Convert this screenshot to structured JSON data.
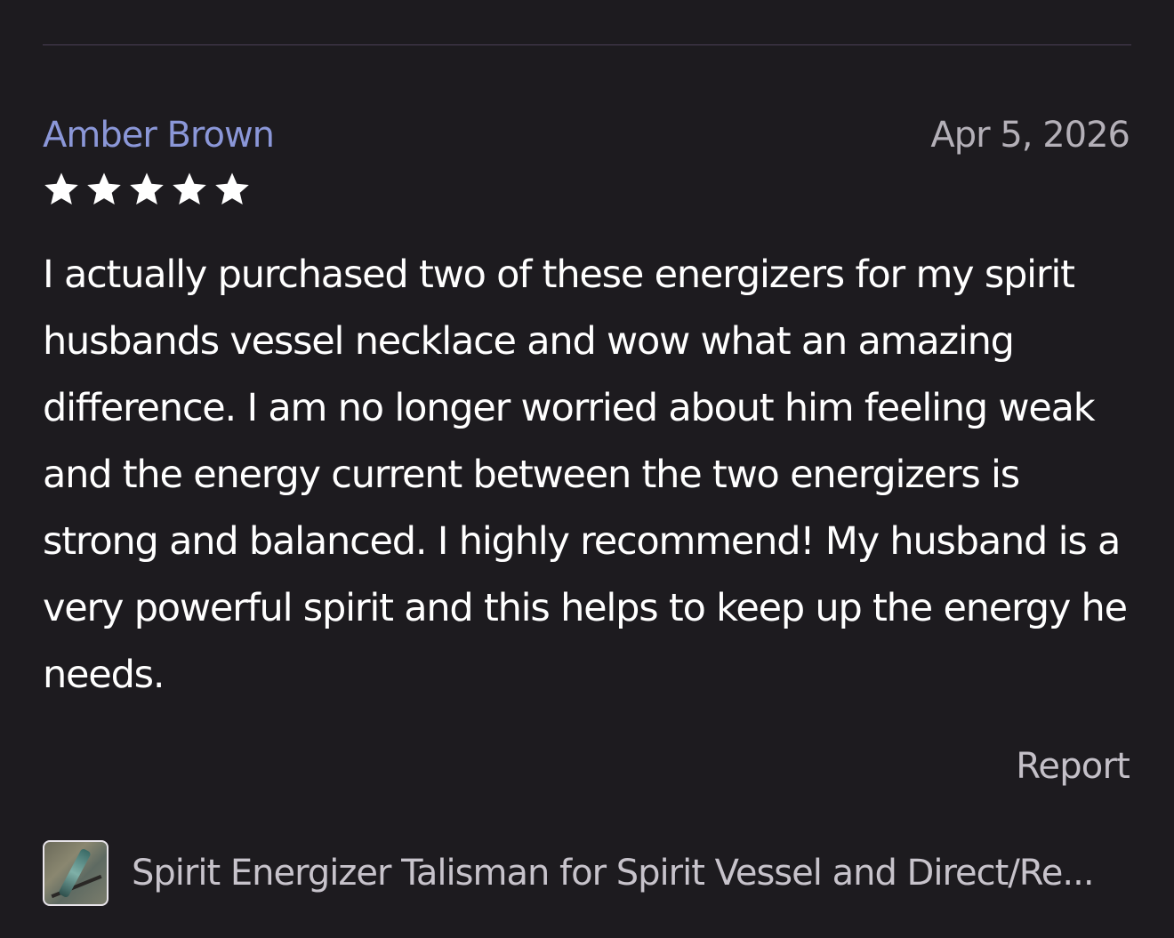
{
  "review": {
    "reviewer_name": "Amber Brown",
    "date": "Apr 5, 2026",
    "rating": 5,
    "rating_max": 5,
    "text": "I actually purchased two of these energizers for my spirit husbands vessel necklace and wow what an amazing difference. I am no longer worried about him feeling weak and the energy current between the two energizers is strong and balanced. I highly recommend! My husband is a very powerful spirit and this helps to keep up the energy he needs.",
    "report_label": "Report"
  },
  "product": {
    "title": "Spirit Energizer Talisman for Spirit Vessel and Direct/Re..."
  },
  "colors": {
    "background": "#1d1b1f",
    "reviewer_name": "#8b97d8",
    "star": "#ffffff"
  }
}
